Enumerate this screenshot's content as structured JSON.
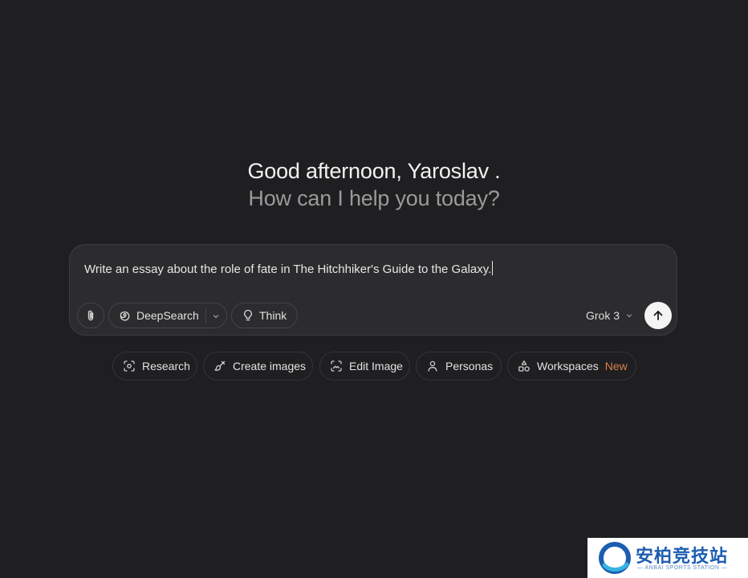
{
  "greeting": {
    "line1": "Good afternoon, Yaroslav .",
    "line2": "How can I help you today?"
  },
  "composer": {
    "prompt_text": "Write an essay about the role of fate in The Hitchhiker's Guide to the Galaxy.",
    "attach_icon": "paperclip-icon",
    "deepsearch_label": "DeepSearch",
    "deepsearch_icon": "swirl-icon",
    "think_label": "Think",
    "think_icon": "lightbulb-icon",
    "model_label": "Grok 3",
    "send_icon": "arrow-up-icon"
  },
  "actions": [
    {
      "label": "Research",
      "icon": "scan-icon"
    },
    {
      "label": "Create images",
      "icon": "paintbrush-icon"
    },
    {
      "label": "Edit Image",
      "icon": "image-edit-icon"
    },
    {
      "label": "Personas",
      "icon": "person-icon"
    },
    {
      "label": "Workspaces",
      "icon": "shapes-icon",
      "badge": "New"
    }
  ],
  "watermark": {
    "title": "安柏竞技站",
    "subtitle": "— ANBAI SPORTS STATION —"
  },
  "colors": {
    "background": "#1f1f21",
    "composer": "#2c2c2e",
    "badge_new": "#d9804f",
    "send_button": "#f4f4f4",
    "watermark_text": "#1c5db2"
  }
}
